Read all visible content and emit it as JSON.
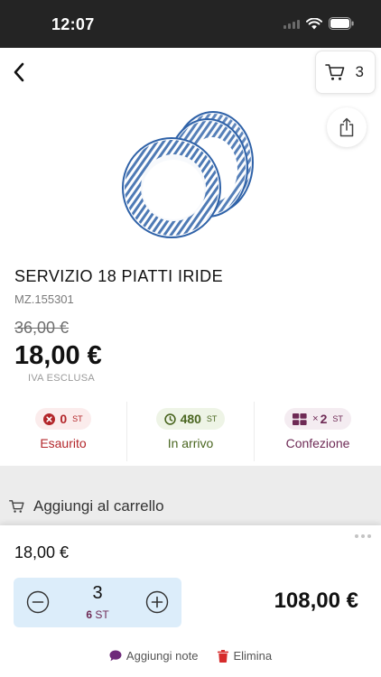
{
  "status_bar": {
    "time": "12:07"
  },
  "cart": {
    "count": "3"
  },
  "product": {
    "title": "SERVIZIO 18 PIATTI IRIDE",
    "code": "MZ.155301",
    "old_price": "36,00 €",
    "price": "18,00 €",
    "vat_note": "IVA ESCLUSA"
  },
  "stock": [
    {
      "value": "0",
      "unit": "ST",
      "label": "Esaurito",
      "icon": "x-circle-icon",
      "color": "#b3262a"
    },
    {
      "value": "480",
      "unit": "ST",
      "label": "In arrivo",
      "icon": "clock-icon",
      "color": "#4a6620"
    },
    {
      "prefix": "×",
      "value": "2",
      "unit": "ST",
      "label": "Confezione",
      "icon": "boxes-icon",
      "color": "#6e2a55"
    }
  ],
  "add_to_cart": {
    "label": "Aggiungi al carrello",
    "icon": "cart-icon"
  },
  "line": {
    "unit_price": "18,00 €",
    "quantity": "3",
    "pieces_value": "6",
    "pieces_unit": "ST",
    "total": "108,00 €"
  },
  "actions": {
    "notes_label": "Aggiungi note",
    "delete_label": "Elimina",
    "notes_color": "#6e2a7a",
    "delete_color": "#d62c2c"
  }
}
